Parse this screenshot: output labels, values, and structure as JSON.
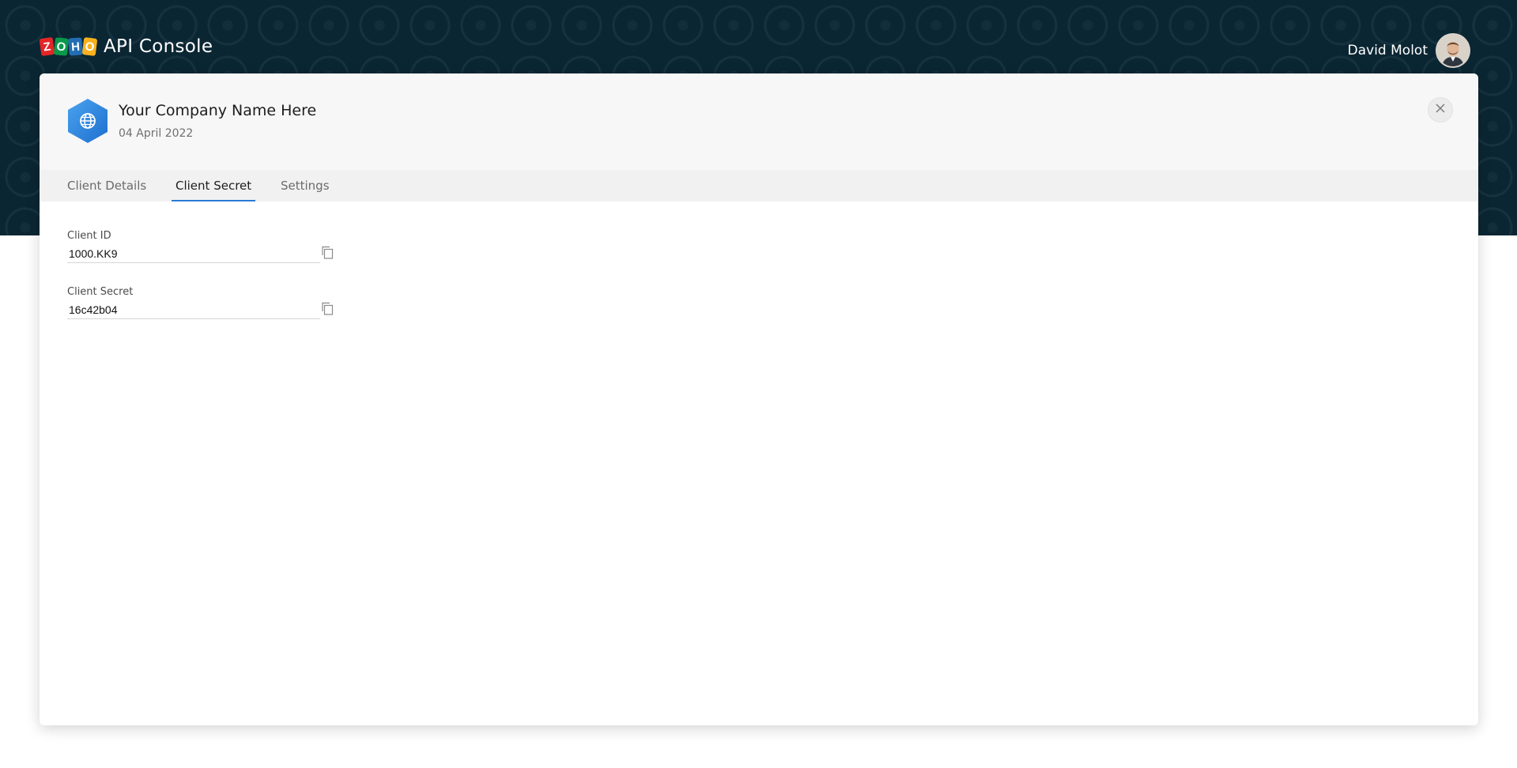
{
  "header": {
    "logo_letters": [
      "Z",
      "O",
      "H",
      "O"
    ],
    "title": "API Console",
    "user_name": "David Molot"
  },
  "client": {
    "name": "Your Company Name Here",
    "date": "04 April 2022",
    "icon": "globe-icon"
  },
  "tabs": [
    {
      "label": "Client Details"
    },
    {
      "label": "Client Secret"
    },
    {
      "label": "Settings"
    }
  ],
  "active_tab": "Client Secret",
  "fields": {
    "client_id": {
      "label": "Client ID",
      "value": "1000.KK9"
    },
    "client_secret": {
      "label": "Client Secret",
      "value": "16c42b04"
    }
  },
  "colors": {
    "header_bg": "#0b2633",
    "accent": "#2a7ad3",
    "zoho_red": "#e42527",
    "zoho_green": "#089949",
    "zoho_blue": "#226db4",
    "zoho_yellow": "#f9b21d"
  }
}
